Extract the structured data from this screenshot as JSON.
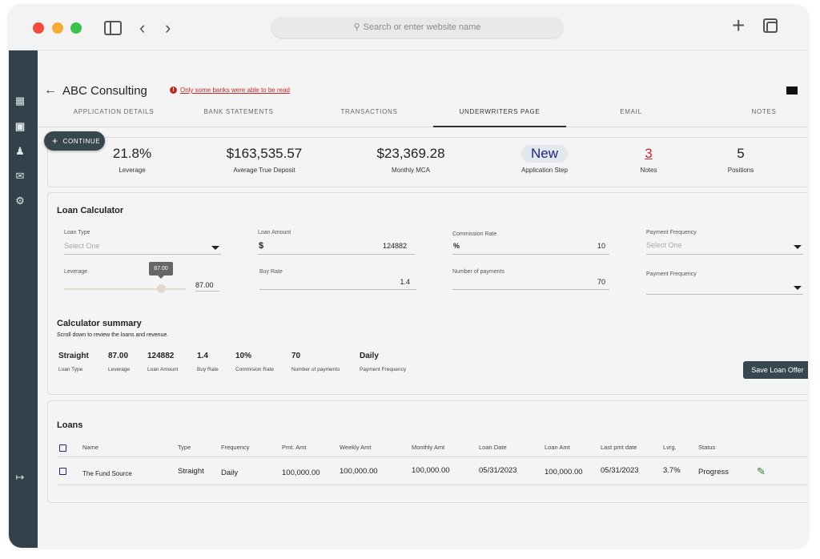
{
  "browser": {
    "search_placeholder": "Search or enter website name",
    "search_icon": "magnifier-icon",
    "icons": [
      "sidebar-toggle-icon",
      "chevron-left-icon",
      "chevron-right-icon",
      "plus-icon",
      "tabs-icon"
    ]
  },
  "rail": {
    "icons": [
      "dashboard-icon",
      "document-icon",
      "people-icon",
      "mail-icon",
      "gear-icon",
      "logout-icon"
    ]
  },
  "header": {
    "back_icon": "←",
    "company": "ABC Consulting",
    "warning": "Only some banks were able to be read"
  },
  "tabs": [
    {
      "label": "APPLICATION DETAILS",
      "active": false
    },
    {
      "label": "BANK STATEMENTS",
      "active": false
    },
    {
      "label": "TRANSACTIONS",
      "active": false
    },
    {
      "label": "UNDERWRITERS PAGE",
      "active": true
    },
    {
      "label": "EMAIL",
      "active": false
    },
    {
      "label": "NOTES",
      "active": false
    }
  ],
  "continue_button": {
    "icon": "+",
    "label": "CONTINUE"
  },
  "stats": {
    "leverage": {
      "value": "21.8%",
      "label": "Leverage"
    },
    "avg_deposit": {
      "value": "$163,535.57",
      "label": "Average True Deposit"
    },
    "monthly_mca": {
      "value": "$23,369.28",
      "label": "Monthly MCA"
    },
    "app_step": {
      "value": "New",
      "label": "Application Step"
    },
    "notes": {
      "value": "3",
      "label": "Notes"
    },
    "positions": {
      "value": "5",
      "label": "Positions"
    }
  },
  "calculator": {
    "title": "Loan Calculator",
    "loan_type": {
      "label": "Loan Type",
      "placeholder": "Select One"
    },
    "loan_amount": {
      "label": "Loan Amount",
      "prefix": "$",
      "value": "124882"
    },
    "commission_rate": {
      "label": "Commission Rate",
      "prefix": "%",
      "value": "10"
    },
    "payment_frequency_1": {
      "label": "Payment Frequency",
      "placeholder": "Select One"
    },
    "leverage": {
      "label": "Leverage",
      "tooltip": "87.00",
      "value": "87.00",
      "level": 0.87
    },
    "buy_rate": {
      "label": "Buy Rate",
      "value": "1.4"
    },
    "num_payments": {
      "label": "Number of payments",
      "value": "70"
    },
    "payment_frequency_2": {
      "label": "Payment Frequency"
    }
  },
  "summary": {
    "title": "Calculator summary",
    "subtitle": "Scroll down to review the loans and revenue.",
    "items": [
      {
        "value": "Straight",
        "label": "Loan Type"
      },
      {
        "value": "87.00",
        "label": "Leverage"
      },
      {
        "value": "124882",
        "label": "Loan Amount"
      },
      {
        "value": "1.4",
        "label": "Buy Rate"
      },
      {
        "value": "10%",
        "label": "Commision Rate"
      },
      {
        "value": "70",
        "label": "Number of payments"
      },
      {
        "value": "Daily",
        "label": "Payment Frequency"
      }
    ],
    "save_label": "Save Loan Offer"
  },
  "loans": {
    "title": "Loans",
    "columns": [
      "Name",
      "Type",
      "Frequency",
      "Pmt. Amt",
      "Weekly Amt",
      "Monthly Amt",
      "Loan Date",
      "Loan Amt",
      "Last pmt date",
      "Lvrg.",
      "Status"
    ],
    "rows": [
      [
        "The Fund Source",
        "Straight",
        "Daily",
        "100,000.00",
        "100,000.00",
        "100,000.00",
        "05/31/2023",
        "100,000.00",
        "05/31/2023",
        "3.7%",
        "Progress"
      ]
    ],
    "edit_icon": "pencil-icon"
  }
}
